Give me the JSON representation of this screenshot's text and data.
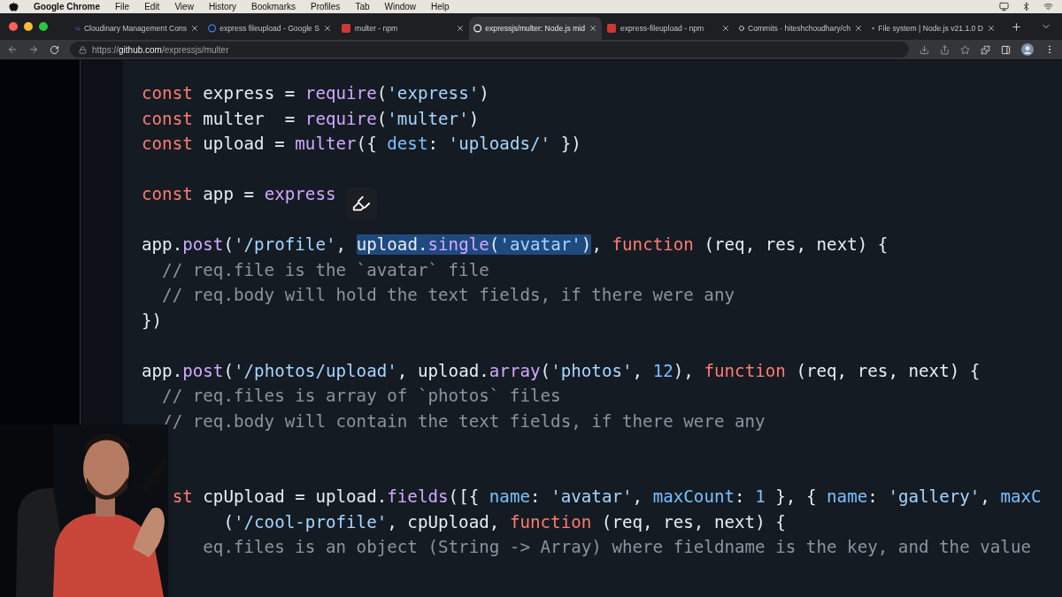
{
  "menu_bar": {
    "app": "Google Chrome",
    "items": [
      "File",
      "Edit",
      "View",
      "History",
      "Bookmarks",
      "Profiles",
      "Tab",
      "Window",
      "Help"
    ]
  },
  "tabs": [
    {
      "title": "Cloudinary Management Cons",
      "selected": false
    },
    {
      "title": "express fileupload - Google S",
      "selected": false
    },
    {
      "title": "multer - npm",
      "selected": false
    },
    {
      "title": "expressjs/multer: Node.js mid",
      "selected": true
    },
    {
      "title": "express-fileupload - npm",
      "selected": false
    },
    {
      "title": "Commits · hiteshchoudhary/ch",
      "selected": false
    },
    {
      "title": "File system | Node.js v21.1.0 D",
      "selected": false
    }
  ],
  "address_bar": {
    "scheme": "https://",
    "host": "github.com",
    "path": "/expressjs/multer"
  },
  "code": {
    "lines": [
      {
        "kind": "code",
        "tokens": [
          {
            "kind": "keyword",
            "text": "const"
          },
          {
            "kind": "plain",
            "text": " express = "
          },
          {
            "kind": "function",
            "text": "require"
          },
          {
            "kind": "plain",
            "text": "("
          },
          {
            "kind": "string",
            "text": "'express'"
          },
          {
            "kind": "plain",
            "text": ")"
          }
        ]
      },
      {
        "kind": "code",
        "tokens": [
          {
            "kind": "keyword",
            "text": "const"
          },
          {
            "kind": "plain",
            "text": " multer  = "
          },
          {
            "kind": "function",
            "text": "require"
          },
          {
            "kind": "plain",
            "text": "("
          },
          {
            "kind": "string",
            "text": "'multer'"
          },
          {
            "kind": "plain",
            "text": ")"
          }
        ]
      },
      {
        "kind": "code",
        "tokens": [
          {
            "kind": "keyword",
            "text": "const"
          },
          {
            "kind": "plain",
            "text": " upload = "
          },
          {
            "kind": "function",
            "text": "multer"
          },
          {
            "kind": "plain",
            "text": "({ "
          },
          {
            "kind": "property",
            "text": "dest"
          },
          {
            "kind": "plain",
            "text": ": "
          },
          {
            "kind": "string",
            "text": "'uploads/'"
          },
          {
            "kind": "plain",
            "text": " })"
          }
        ]
      },
      {
        "kind": "blank"
      },
      {
        "kind": "code",
        "tokens": [
          {
            "kind": "keyword",
            "text": "const"
          },
          {
            "kind": "plain",
            "text": " app = "
          },
          {
            "kind": "function",
            "text": "express"
          }
        ]
      },
      {
        "kind": "blank"
      },
      {
        "kind": "code",
        "tokens": [
          {
            "kind": "plain",
            "text": "app."
          },
          {
            "kind": "function",
            "text": "post"
          },
          {
            "kind": "plain",
            "text": "("
          },
          {
            "kind": "string",
            "text": "'/profile'"
          },
          {
            "kind": "plain",
            "text": ", "
          },
          {
            "kind": "selection",
            "tokens": [
              {
                "kind": "plain",
                "text": "upload."
              },
              {
                "kind": "function",
                "text": "single"
              },
              {
                "kind": "plain",
                "text": "("
              },
              {
                "kind": "string",
                "text": "'avatar'"
              },
              {
                "kind": "plain",
                "text": ")"
              }
            ]
          },
          {
            "kind": "plain",
            "text": ", "
          },
          {
            "kind": "keyword",
            "text": "function"
          },
          {
            "kind": "plain",
            "text": " (req, res, next) {"
          }
        ]
      },
      {
        "kind": "code",
        "tokens": [
          {
            "kind": "comment",
            "text": "  // req.file is the `avatar` file"
          }
        ]
      },
      {
        "kind": "code",
        "tokens": [
          {
            "kind": "comment",
            "text": "  // req.body will hold the text fields, if there were any"
          }
        ]
      },
      {
        "kind": "code",
        "tokens": [
          {
            "kind": "plain",
            "text": "})"
          }
        ]
      },
      {
        "kind": "blank"
      },
      {
        "kind": "code",
        "tokens": [
          {
            "kind": "plain",
            "text": "app."
          },
          {
            "kind": "function",
            "text": "post"
          },
          {
            "kind": "plain",
            "text": "("
          },
          {
            "kind": "string",
            "text": "'/photos/upload'"
          },
          {
            "kind": "plain",
            "text": ", upload."
          },
          {
            "kind": "function",
            "text": "array"
          },
          {
            "kind": "plain",
            "text": "("
          },
          {
            "kind": "string",
            "text": "'photos'"
          },
          {
            "kind": "plain",
            "text": ", "
          },
          {
            "kind": "number",
            "text": "12"
          },
          {
            "kind": "plain",
            "text": "), "
          },
          {
            "kind": "keyword",
            "text": "function"
          },
          {
            "kind": "plain",
            "text": " (req, res, next) {"
          }
        ]
      },
      {
        "kind": "code",
        "tokens": [
          {
            "kind": "comment",
            "text": "  // req.files is array of `photos` files"
          }
        ]
      },
      {
        "kind": "code",
        "tokens": [
          {
            "kind": "comment",
            "text": "  // req.body will contain the text fields, if there were any"
          }
        ]
      },
      {
        "kind": "blank"
      },
      {
        "kind": "blank"
      },
      {
        "kind": "code",
        "tokens": [
          {
            "kind": "keyword",
            "text": "   st"
          },
          {
            "kind": "plain",
            "text": " cpUpload = upload."
          },
          {
            "kind": "function",
            "text": "fields"
          },
          {
            "kind": "plain",
            "text": "([{ "
          },
          {
            "kind": "property",
            "text": "name"
          },
          {
            "kind": "plain",
            "text": ": "
          },
          {
            "kind": "string",
            "text": "'avatar'"
          },
          {
            "kind": "plain",
            "text": ", "
          },
          {
            "kind": "property",
            "text": "maxCount"
          },
          {
            "kind": "plain",
            "text": ": "
          },
          {
            "kind": "number",
            "text": "1"
          },
          {
            "kind": "plain",
            "text": " }, { "
          },
          {
            "kind": "property",
            "text": "name"
          },
          {
            "kind": "plain",
            "text": ": "
          },
          {
            "kind": "string",
            "text": "'gallery'"
          },
          {
            "kind": "plain",
            "text": ", "
          },
          {
            "kind": "property",
            "text": "maxC"
          }
        ]
      },
      {
        "kind": "code",
        "tokens": [
          {
            "kind": "plain",
            "text": "        ("
          },
          {
            "kind": "string",
            "text": "'/cool-profile'"
          },
          {
            "kind": "plain",
            "text": ", cpUpload, "
          },
          {
            "kind": "keyword",
            "text": "function"
          },
          {
            "kind": "plain",
            "text": " (req, res, next) {"
          }
        ]
      },
      {
        "kind": "code",
        "tokens": [
          {
            "kind": "comment",
            "text": "      eq.files is an object (String -> Array) where fieldname is the key, and the value"
          }
        ]
      }
    ]
  }
}
